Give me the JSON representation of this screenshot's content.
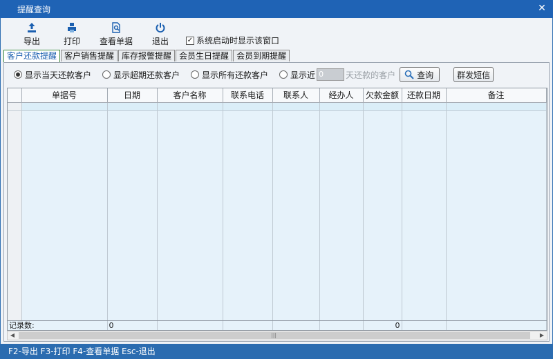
{
  "window": {
    "title": "提醒查询"
  },
  "toolbar": {
    "export_label": "导出",
    "print_label": "打印",
    "view_label": "查看单据",
    "exit_label": "退出",
    "startup_checkbox_label": "系统启动时显示该窗口",
    "startup_checked": true
  },
  "tabs": [
    {
      "label": "客户还款提醒",
      "active": true
    },
    {
      "label": "客户销售提醒",
      "active": false
    },
    {
      "label": "库存报警提醒",
      "active": false
    },
    {
      "label": "会员生日提醒",
      "active": false
    },
    {
      "label": "会员到期提醒",
      "active": false
    }
  ],
  "filter": {
    "opt_today": "显示当天还款客户",
    "opt_overdue": "显示超期还款客户",
    "opt_all": "显示所有还款客户",
    "opt_near": "显示近",
    "days_value": "0",
    "days_suffix": "天还款的客户",
    "selected": "opt_today",
    "query_label": "查询",
    "sms_label": "群发短信"
  },
  "grid": {
    "columns": [
      "单据号",
      "日期",
      "客户名称",
      "联系电话",
      "联系人",
      "经办人",
      "欠款金额",
      "还款日期",
      "备注"
    ],
    "rows": []
  },
  "footer": {
    "record_label": "记录数:",
    "record_count": "0",
    "amount_total": "0"
  },
  "statusbar": {
    "shortcuts": "F2-导出 F3-打印 F4-查看单据 Esc-退出"
  },
  "colors": {
    "titlebar": "#1f63b5",
    "statusbar": "#2b6cb0",
    "grid_bg": "#e6f2fa",
    "active_tab_border": "#3c8a3c"
  }
}
